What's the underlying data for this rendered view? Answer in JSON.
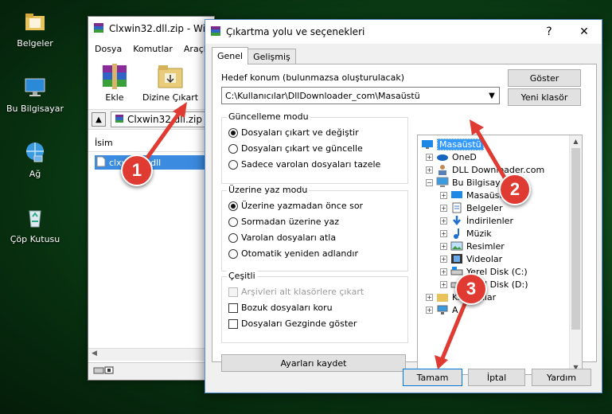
{
  "desktop": {
    "icons": [
      {
        "label": "Belgeler"
      },
      {
        "label": "Bu Bilgisayar"
      },
      {
        "label": "Ağ"
      },
      {
        "label": "Çöp Kutusu"
      }
    ]
  },
  "winrar": {
    "title": "Clxwin32.dll.zip - Wi",
    "menu": [
      "Dosya",
      "Komutlar",
      "Araçla"
    ],
    "toolbar": {
      "extract_label": "Ekle",
      "extract_to_label": "Dizine Çıkart"
    },
    "path": "Clxwin32.dll.zip",
    "column_name": "İsim",
    "file": "clxwin32.dll"
  },
  "dialog": {
    "title": "Çıkartma yolu ve seçenekleri",
    "help": "?",
    "close": "✕",
    "tabs": [
      "Genel",
      "Gelişmiş"
    ],
    "destination_label": "Hedef konum (bulunmazsa oluşturulacak)",
    "destination_value": "C:\\Kullanıcılar\\DllDownloader_com\\Masaüstü",
    "show_button": "Göster",
    "new_folder_button": "Yeni klasör",
    "update_mode": {
      "title": "Güncelleme modu",
      "options": [
        "Dosyaları çıkart ve değiştir",
        "Dosyaları çıkart ve güncelle",
        "Sadece varolan dosyaları tazele"
      ]
    },
    "overwrite_mode": {
      "title": "Üzerine yaz modu",
      "options": [
        "Üzerine yazmadan önce sor",
        "Sormadan üzerine yaz",
        "Varolan dosyaları atla",
        "Otomatik yeniden adlandır"
      ]
    },
    "misc": {
      "title": "Çeşitli",
      "options": [
        "Arşivleri alt klasörlere çıkart",
        "Bozuk dosyaları koru",
        "Dosyaları Gezginde göster"
      ]
    },
    "save_settings": "Ayarları kaydet",
    "tree": [
      {
        "label": "Masaüstü"
      },
      {
        "label": "OneD"
      },
      {
        "label": "DLL Downloader.com"
      },
      {
        "label": "Bu Bilgisay"
      },
      {
        "label": "Masaüstü"
      },
      {
        "label": "Belgeler"
      },
      {
        "label": "İndirilenler"
      },
      {
        "label": "Müzik"
      },
      {
        "label": "Resimler"
      },
      {
        "label": "Videolar"
      },
      {
        "label": "Yerel Disk (C:)"
      },
      {
        "label": "Yerel Disk (D:)"
      },
      {
        "label": "Kitaplıklar"
      },
      {
        "label": "A"
      }
    ],
    "ok": "Tamam",
    "cancel": "İptal",
    "help_button": "Yardım"
  },
  "annotations": [
    "1",
    "2",
    "3"
  ],
  "colors": {
    "accent": "#3399ff",
    "badge": "#e03b33"
  }
}
